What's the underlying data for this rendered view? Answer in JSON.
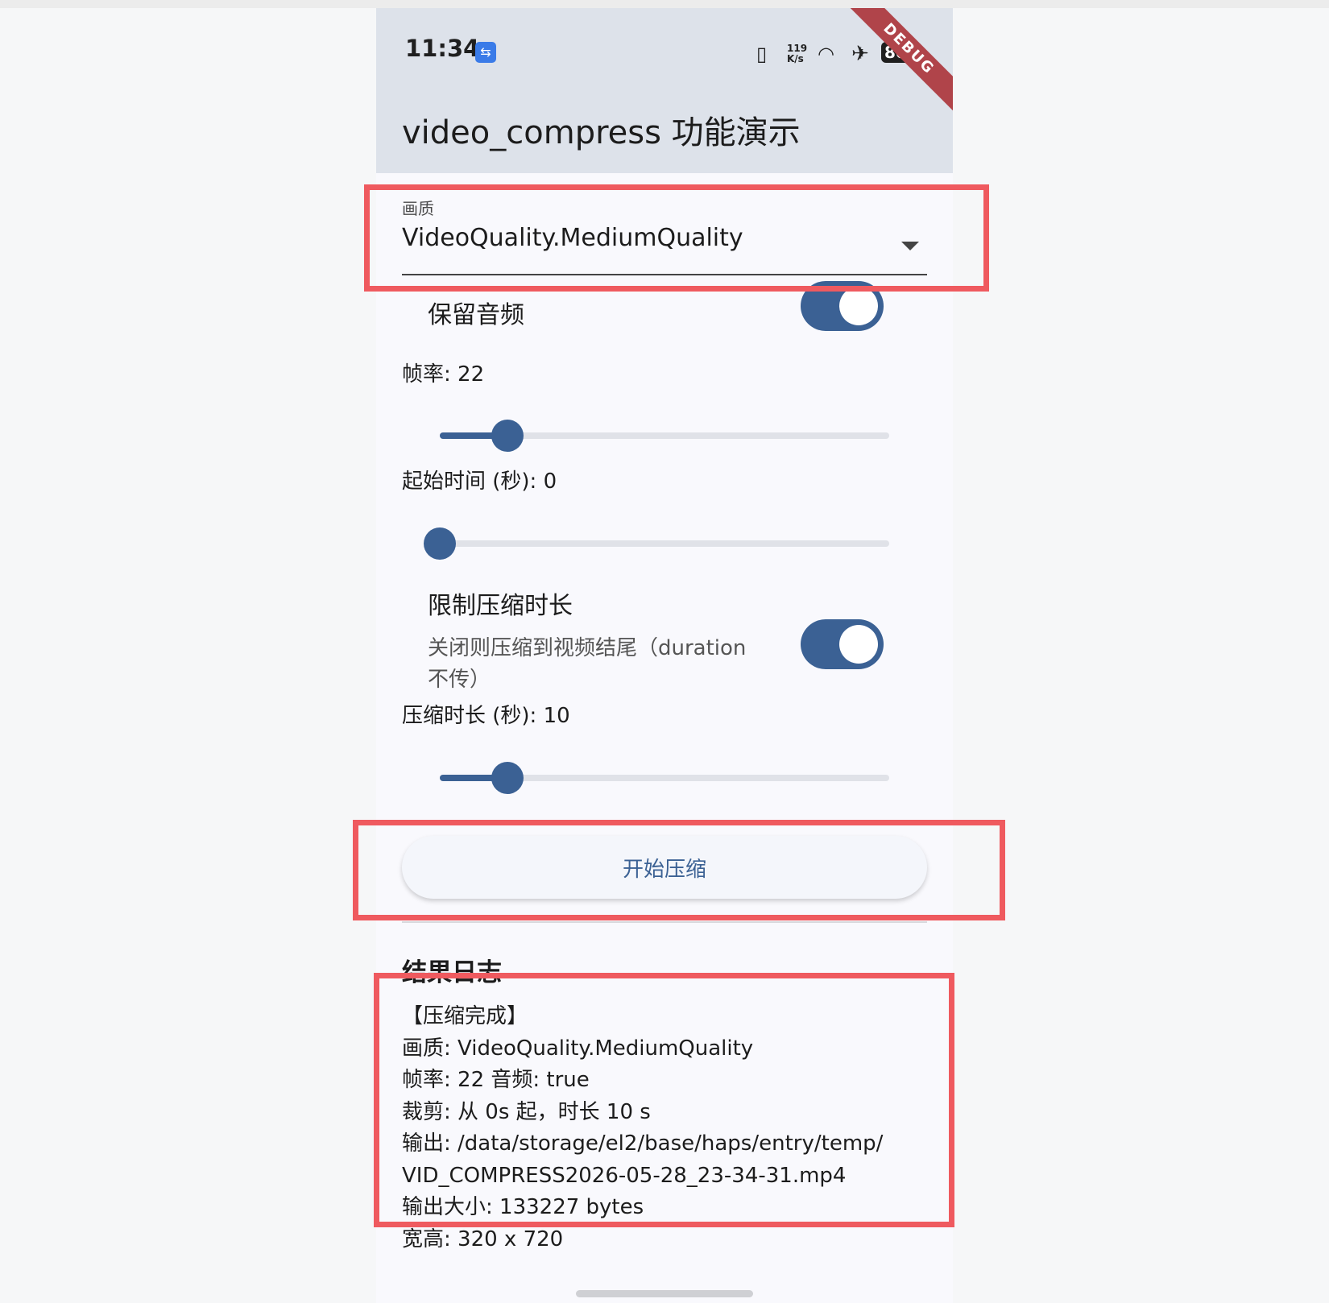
{
  "status_bar": {
    "time": "11:34",
    "usb_icon": "usb-icon",
    "speed_top": "119",
    "speed_bottom": "K/s",
    "battery": "80",
    "debug_banner": "DEBUG"
  },
  "app_bar": {
    "title": "video_compress 功能演示"
  },
  "quality": {
    "label": "画质",
    "value": "VideoQuality.MediumQuality"
  },
  "keep_audio": {
    "label": "保留音频",
    "on": true
  },
  "frame_rate": {
    "label": "帧率: 22",
    "value": 22,
    "fraction": 0.15
  },
  "start_time": {
    "label": "起始时间 (秒): 0",
    "value": 0,
    "fraction": 0.0
  },
  "limit_duration": {
    "label": "限制压缩时长",
    "subtitle_line1": "关闭则压缩到视频结尾（duration",
    "subtitle_line2": "不传）",
    "on": true
  },
  "duration": {
    "label": "压缩时长 (秒): 10",
    "value": 10,
    "fraction": 0.15
  },
  "start_button": {
    "label": "开始压缩"
  },
  "log": {
    "title": "结果日志",
    "lines": [
      "【压缩完成】",
      "画质: VideoQuality.MediumQuality",
      "帧率: 22  音频: true",
      "裁剪: 从 0s 起，时长 10 s",
      "输出: /data/storage/el2/base/haps/entry/temp/",
      "VID_COMPRESS2026-05-28_23-34-31.mp4",
      "输出大小: 133227 bytes",
      "宽高: 320 x 720"
    ]
  },
  "colors": {
    "accent": "#3b6194",
    "highlight": "#ef5a5f",
    "appbar": "#dde2ea"
  }
}
